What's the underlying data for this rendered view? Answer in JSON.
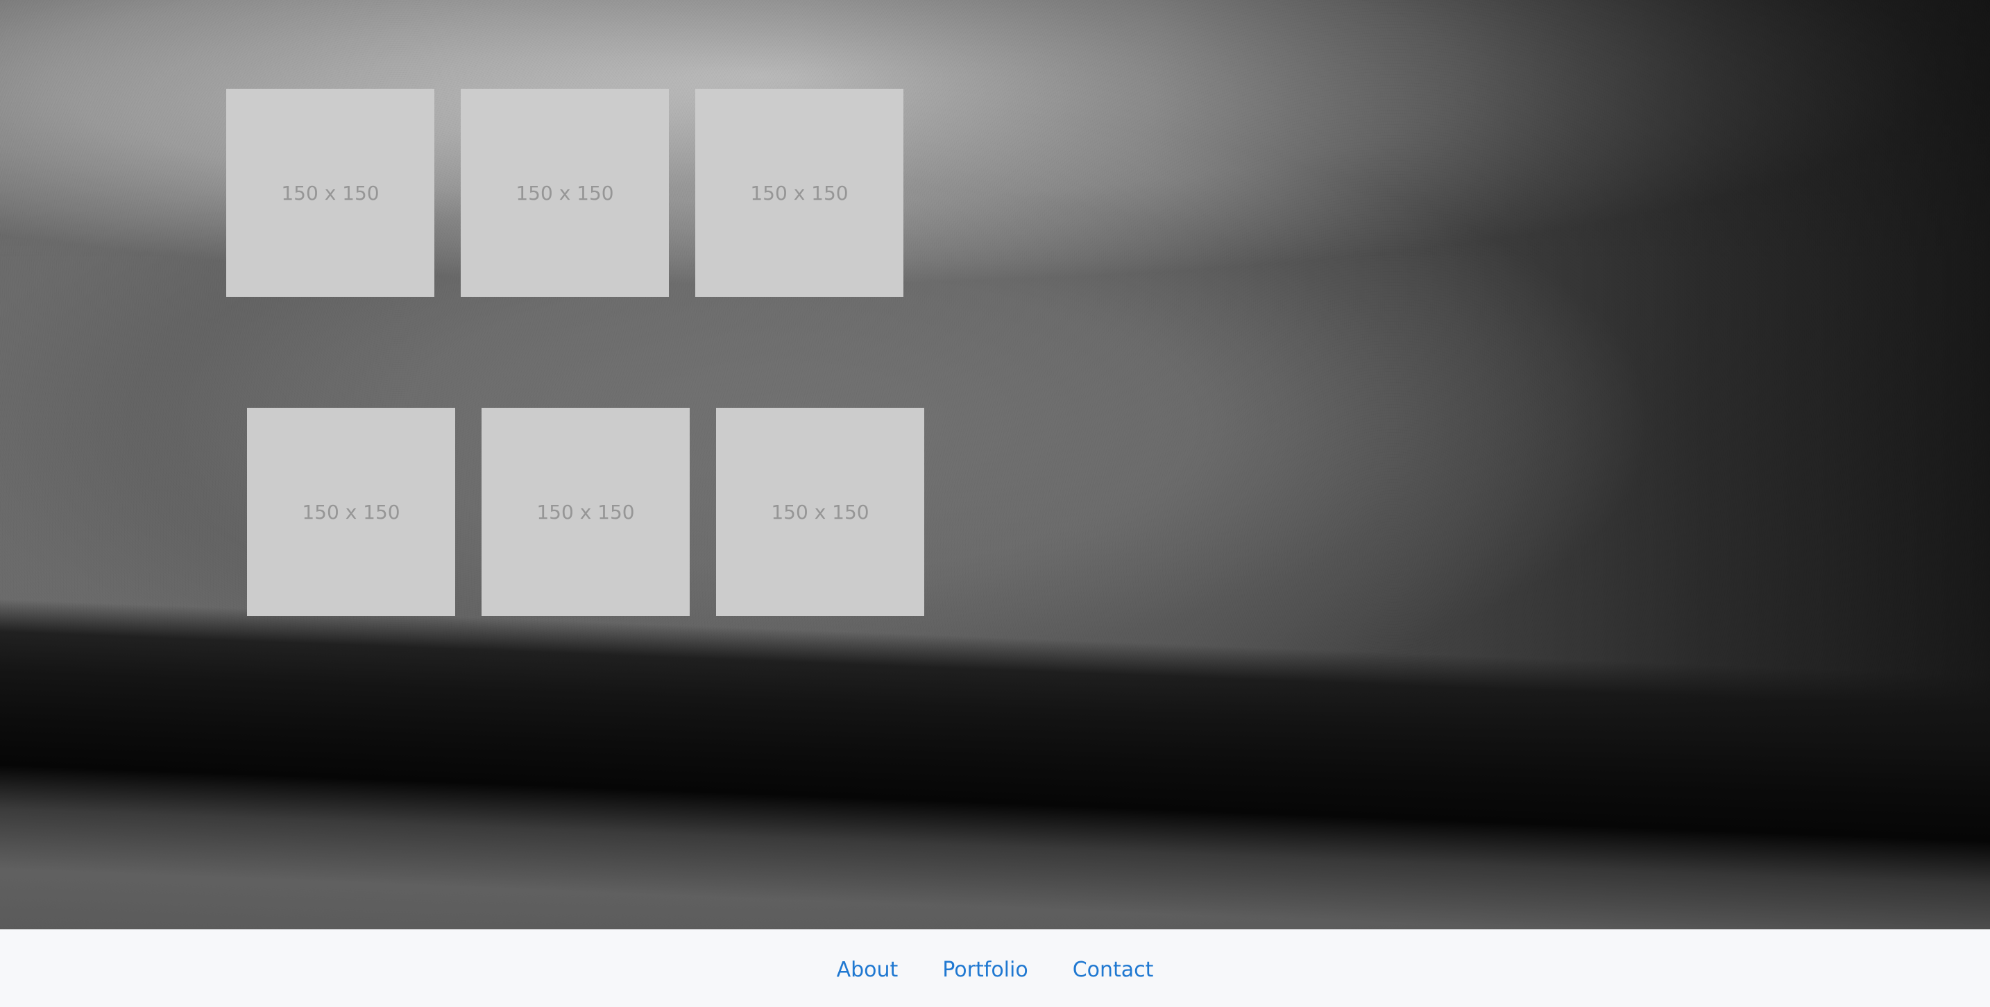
{
  "gallery": {
    "thumbnails": [
      {
        "label": "150 x 150"
      },
      {
        "label": "150 x 150"
      },
      {
        "label": "150 x 150"
      },
      {
        "label": "150 x 150"
      },
      {
        "label": "150 x 150"
      },
      {
        "label": "150 x 150"
      }
    ]
  },
  "footer": {
    "links": [
      {
        "label": "About"
      },
      {
        "label": "Portfolio"
      },
      {
        "label": "Contact"
      }
    ]
  },
  "colors": {
    "placeholder_bg": "#cccccc",
    "placeholder_text": "#969696",
    "footer_bg": "#f7f8fa",
    "link": "#1f78d1"
  }
}
